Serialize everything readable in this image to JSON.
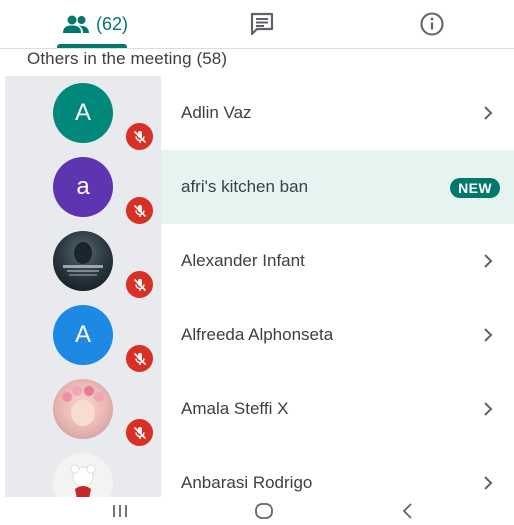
{
  "tabs": {
    "people_count": "(62)"
  },
  "section_title": "Others in the meeting (58)",
  "participants": [
    {
      "name": "Adlin Vaz",
      "avatar_letter": "A",
      "avatar_color": "#00897b",
      "muted": true,
      "badge": ""
    },
    {
      "name": "afri's kitchen ban",
      "avatar_letter": "a",
      "avatar_color": "#5e35b1",
      "muted": true,
      "badge": "NEW"
    },
    {
      "name": "Alexander Infant",
      "avatar_letter": "",
      "avatar_color": "#1b2a33",
      "muted": true,
      "badge": ""
    },
    {
      "name": "Alfreeda Alphonseta",
      "avatar_letter": "A",
      "avatar_color": "#1e88e5",
      "muted": true,
      "badge": ""
    },
    {
      "name": "Amala Steffi X",
      "avatar_letter": "",
      "avatar_color": "#e9b9b3",
      "muted": true,
      "badge": ""
    },
    {
      "name": "Anbarasi Rodrigo",
      "avatar_letter": "",
      "avatar_color": "#f3f3f3",
      "muted": false,
      "badge": ""
    }
  ],
  "colors": {
    "accent": "#00796b",
    "mute_red": "#d93025",
    "highlight_row": "#e6f4f1"
  }
}
